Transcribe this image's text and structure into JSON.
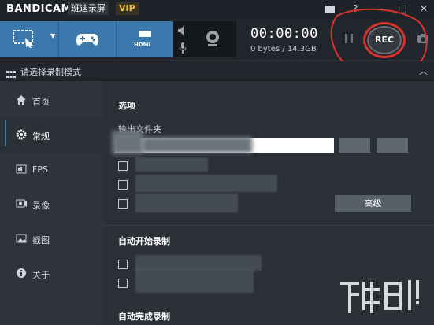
{
  "app": {
    "brand": "BANDICAM",
    "name": "班迪录屏",
    "vip": "VIP"
  },
  "titlebar": {
    "controls": [
      "folder-icon",
      "help-icon",
      "minimize-icon",
      "close-icon"
    ],
    "help_label": "?",
    "minimize_label": "—",
    "close_label": "✕"
  },
  "toolbar": {
    "modes": [
      "screen-rect-icon",
      "gamepad-icon",
      "hdmi-icon"
    ],
    "hdmi_label": "HDMI",
    "timer": "00:00:00",
    "size": "0 bytes / 14.3GB",
    "rec_label": "REC"
  },
  "modebar": {
    "label": "请选择录制模式"
  },
  "sidebar": {
    "items": [
      {
        "label": "首页",
        "icon": "home-icon"
      },
      {
        "label": "常规",
        "icon": "gear-icon",
        "active": true
      },
      {
        "label": "FPS",
        "icon": "fps-icon"
      },
      {
        "label": "录像",
        "icon": "video-icon"
      },
      {
        "label": "截图",
        "icon": "image-icon"
      },
      {
        "label": "关于",
        "icon": "info-icon"
      }
    ]
  },
  "main": {
    "options_title": "选项",
    "output_folder_label": "输出文件夹",
    "advanced_button": "高级",
    "auto_start_title": "自动开始录制",
    "auto_complete_title": "自动完成录制"
  },
  "colors": {
    "accent": "#3b78ad",
    "annotation": "#d9342b"
  }
}
